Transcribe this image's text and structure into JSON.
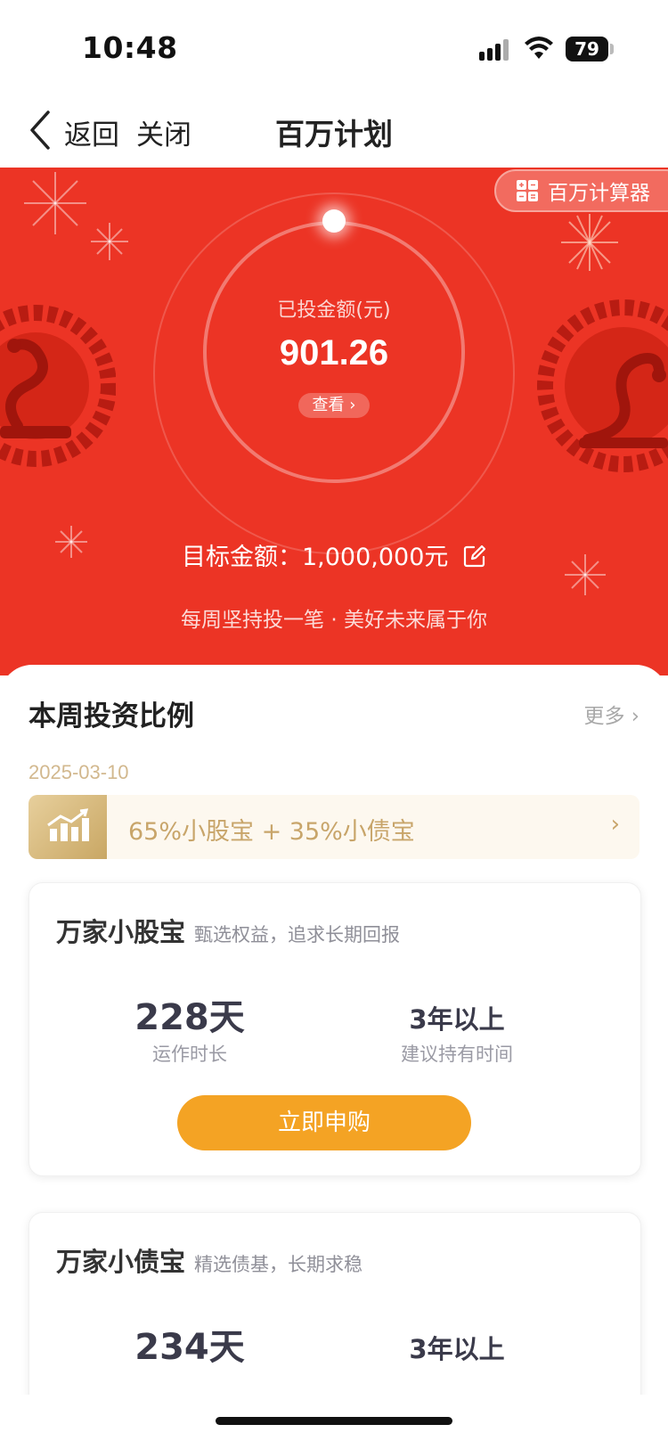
{
  "status_bar": {
    "time": "10:48",
    "battery": "79"
  },
  "nav": {
    "back_label": "返回",
    "close_label": "关闭",
    "title": "百万计划"
  },
  "hero": {
    "calculator_label": "百万计算器",
    "invested_label": "已投金额(元)",
    "invested_amount": "901.26",
    "view_label": "查看 ›",
    "target_text": "目标金额：1,000,000元",
    "slogan": "每周坚持投一笔 · 美好未来属于你",
    "colors": {
      "background": "#ec3425"
    }
  },
  "weekly": {
    "title": "本周投资比例",
    "more_label": "更多 ›",
    "date": "2025-03-10",
    "ratio_text": "65%小股宝 + 35%小债宝",
    "ratio_arrow": "›"
  },
  "products": [
    {
      "name": "万家小股宝",
      "tagline": "甄选权益，追求长期回报",
      "running_days": "228天",
      "running_label": "运作时长",
      "hold_period": "3年以上",
      "hold_label": "建议持有时间",
      "buy_label": "立即申购"
    },
    {
      "name": "万家小债宝",
      "tagline": "精选债基，长期求稳",
      "running_days": "234天",
      "hold_period": "3年以上"
    }
  ],
  "colors": {
    "accent_orange": "#f4a324",
    "gold_text": "#c8a56a"
  }
}
